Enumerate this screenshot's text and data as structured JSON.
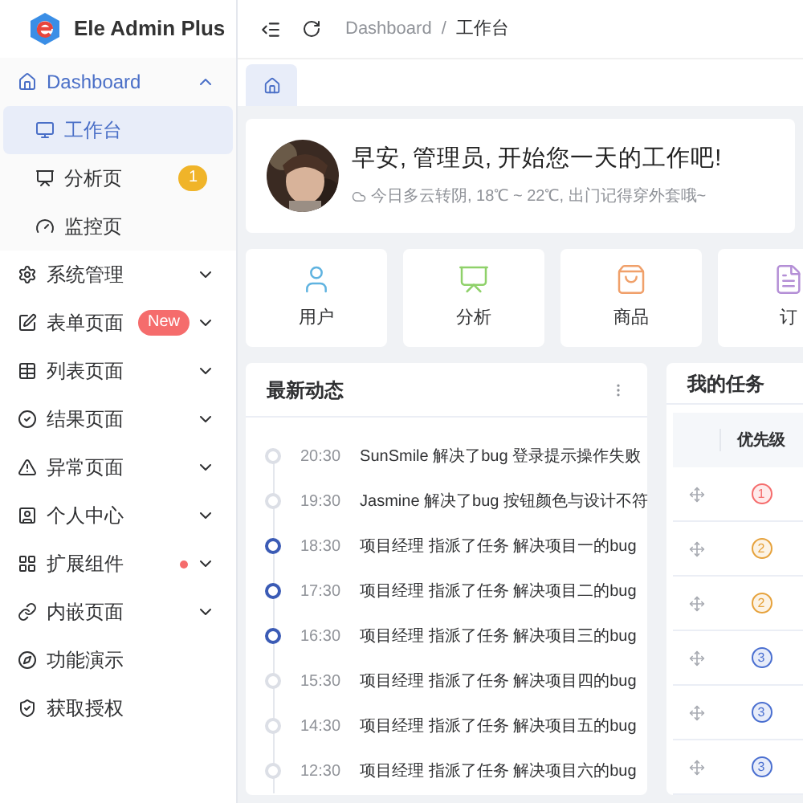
{
  "logo": {
    "title": "Ele Admin Plus"
  },
  "menu": [
    {
      "label": "Dashboard",
      "kind": "group",
      "expanded": true,
      "children": [
        {
          "label": "工作台",
          "selected": true
        },
        {
          "label": "分析页",
          "selected": false,
          "badge": {
            "text": "1",
            "color": "#f0b429"
          }
        },
        {
          "label": "监控页",
          "selected": false
        }
      ]
    },
    {
      "label": "系统管理",
      "kind": "group",
      "expanded": false
    },
    {
      "label": "表单页面",
      "kind": "group",
      "expanded": false,
      "badge": {
        "text": "New",
        "color": "#f56c6c"
      }
    },
    {
      "label": "列表页面",
      "kind": "group",
      "expanded": false
    },
    {
      "label": "结果页面",
      "kind": "group",
      "expanded": false
    },
    {
      "label": "异常页面",
      "kind": "group",
      "expanded": false
    },
    {
      "label": "个人中心",
      "kind": "group",
      "expanded": false
    },
    {
      "label": "扩展组件",
      "kind": "group",
      "expanded": false,
      "dot": {
        "color": "#f56c6c"
      }
    },
    {
      "label": "内嵌页面",
      "kind": "group",
      "expanded": false
    },
    {
      "label": "功能演示",
      "kind": "link"
    },
    {
      "label": "获取授权",
      "kind": "link"
    }
  ],
  "breadcrumb": [
    "Dashboard",
    "工作台"
  ],
  "breadcrumb_separator": "/",
  "welcome": {
    "title": "早安, 管理员, 开始您一天的工作吧!",
    "subtitle": "今日多云转阴, 18℃ ~ 22℃, 出门记得穿外套哦~"
  },
  "shortcuts": [
    {
      "label": "用户",
      "color": "#5fb3e0"
    },
    {
      "label": "分析",
      "color": "#8fd16a"
    },
    {
      "label": "商品",
      "color": "#f0a06a"
    },
    {
      "label": "订",
      "color": "#b48fd6"
    }
  ],
  "activity": {
    "title": "最新动态",
    "items": [
      {
        "time": "20:30",
        "text": "SunSmile 解决了bug 登录提示操作失败",
        "color": "#dcdfe6"
      },
      {
        "time": "19:30",
        "text": "Jasmine 解决了bug 按钮颜色与设计不符",
        "color": "#dcdfe6"
      },
      {
        "time": "18:30",
        "text": "项目经理 指派了任务 解决项目一的bug",
        "color": "#3b5bb5"
      },
      {
        "time": "17:30",
        "text": "项目经理 指派了任务 解决项目二的bug",
        "color": "#3b5bb5"
      },
      {
        "time": "16:30",
        "text": "项目经理 指派了任务 解决项目三的bug",
        "color": "#3b5bb5"
      },
      {
        "time": "15:30",
        "text": "项目经理 指派了任务 解决项目四的bug",
        "color": "#dcdfe6"
      },
      {
        "time": "14:30",
        "text": "项目经理 指派了任务 解决项目五的bug",
        "color": "#dcdfe6"
      },
      {
        "time": "12:30",
        "text": "项目经理 指派了任务 解决项目六的bug",
        "color": "#dcdfe6"
      }
    ]
  },
  "tasks": {
    "title": "我的任务",
    "columns": [
      "优先级"
    ],
    "rows": [
      {
        "priority": "1",
        "color": "#f56c6c"
      },
      {
        "priority": "2",
        "color": "#e6a23c"
      },
      {
        "priority": "2",
        "color": "#e6a23c"
      },
      {
        "priority": "3",
        "color": "#4a6fd0"
      },
      {
        "priority": "3",
        "color": "#4a6fd0"
      },
      {
        "priority": "3",
        "color": "#4a6fd0"
      }
    ]
  }
}
